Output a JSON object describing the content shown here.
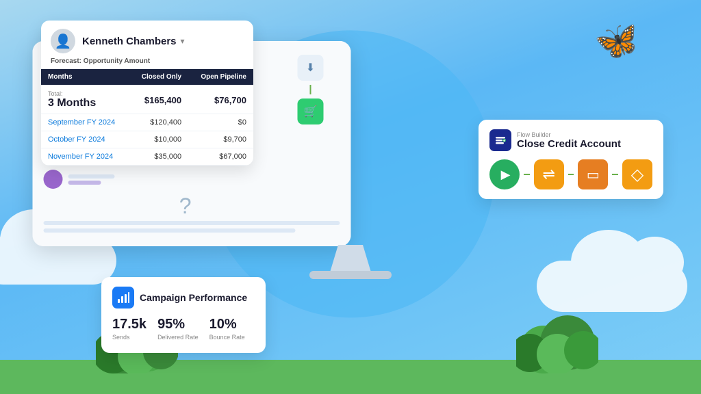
{
  "background": {
    "color": "#5bb8f5"
  },
  "forecast_card": {
    "person_name": "Kenneth Chambers",
    "subtitle_prefix": "Forecast:",
    "subtitle_value": "Opportunity Amount",
    "dropdown_icon": "▾",
    "table": {
      "headers": [
        "Months",
        "Closed Only",
        "Open Pipeline"
      ],
      "total_row": {
        "label": "Total:",
        "period": "3 Months",
        "closed": "$165,400",
        "open": "$76,700"
      },
      "rows": [
        {
          "month": "September FY 2024",
          "closed": "$120,400",
          "open": "$0"
        },
        {
          "month": "October FY 2024",
          "closed": "$10,000",
          "open": "$9,700"
        },
        {
          "month": "November FY 2024",
          "closed": "$35,000",
          "open": "$67,000"
        }
      ]
    }
  },
  "campaign_card": {
    "icon": "📊",
    "title": "Campaign Performance",
    "stats": [
      {
        "value": "17.5k",
        "label": "Sends"
      },
      {
        "value": "95%",
        "label": "Delivered Rate"
      },
      {
        "value": "10%",
        "label": "Bounce Rate"
      }
    ]
  },
  "flow_card": {
    "icon": "≡",
    "label": "Flow Builder",
    "title": "Close Credit Account",
    "steps": [
      {
        "type": "play",
        "symbol": "▶",
        "color": "green"
      },
      {
        "type": "settings",
        "symbol": "⇌",
        "color": "orange"
      },
      {
        "type": "screen",
        "symbol": "▭",
        "color": "orange"
      },
      {
        "type": "diamond",
        "symbol": "◇",
        "color": "orange2"
      }
    ]
  },
  "question_mark": "?",
  "monitor": {
    "list_items": [
      {
        "color": "#c4784a"
      },
      {
        "color": "#3aaa5c"
      },
      {
        "color": "#e06030"
      },
      {
        "color": "#d44444"
      },
      {
        "color": "#9966cc"
      }
    ]
  }
}
